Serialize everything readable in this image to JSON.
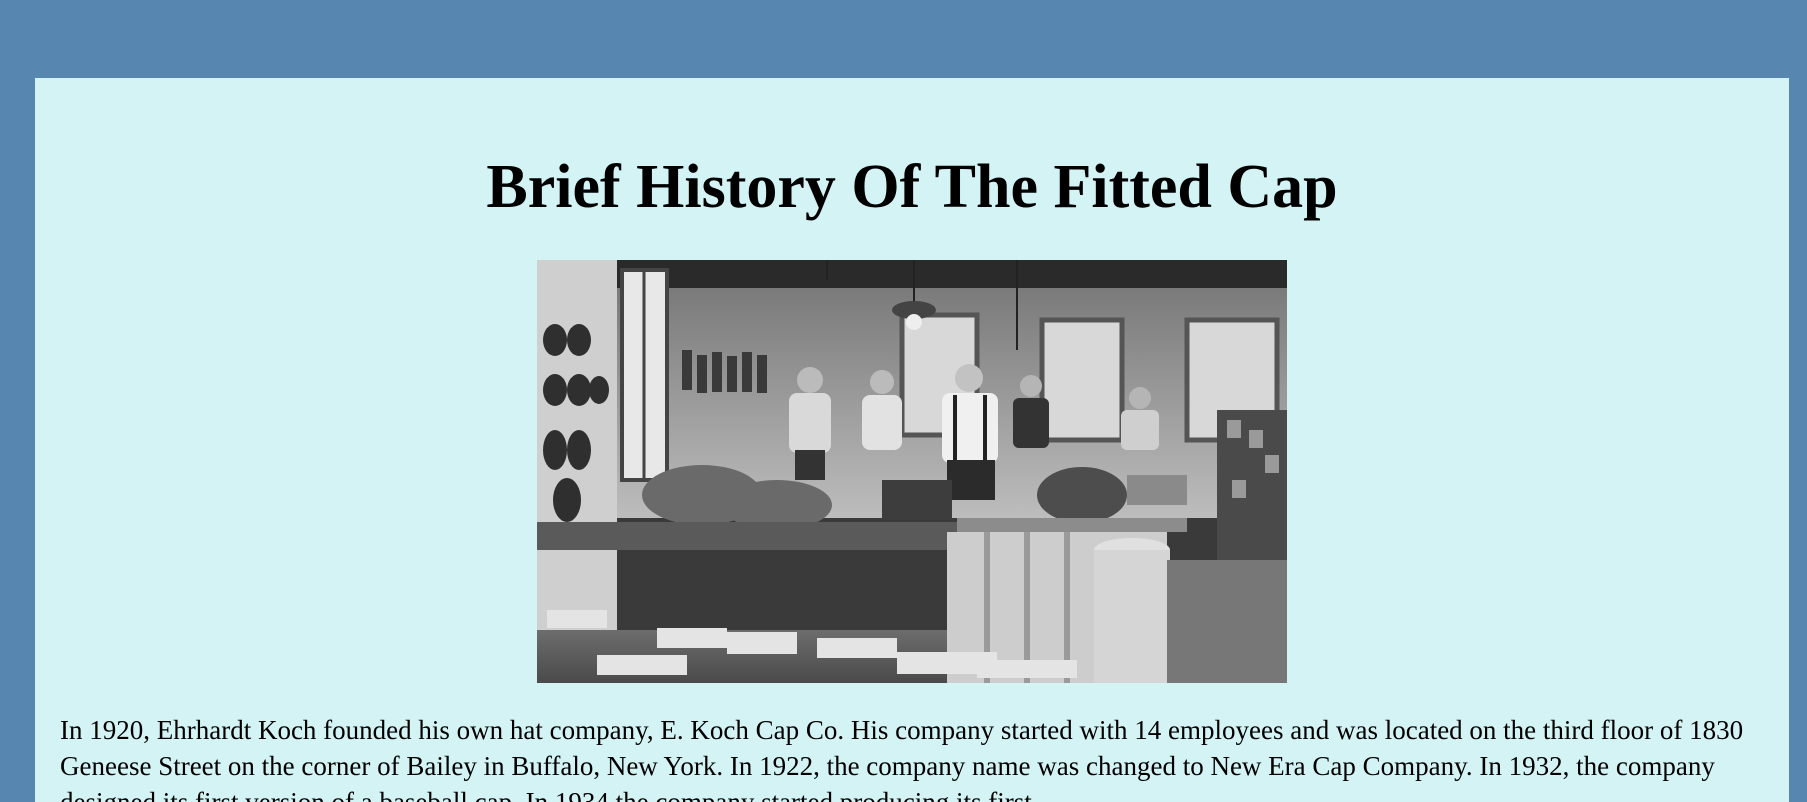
{
  "page": {
    "title": "Brief History Of The Fitted Cap",
    "photo": {
      "alt": "Black and white photo of workers in a cap factory workshop"
    },
    "paragraph": "In 1920, Ehrhardt Koch founded his own hat company, E. Koch Cap Co. His company started with 14 employees and was located on the third floor of 1830 Geneese Street on the corner of Bailey in Buffalo, New York. In 1922, the company name was changed to New Era Cap Company. In 1932, the company designed its first version of a baseball cap. In 1934 the company started producing its first"
  },
  "colors": {
    "outer_background": "#5786b1",
    "page_background": "#d3f3f5",
    "text": "#000000"
  }
}
